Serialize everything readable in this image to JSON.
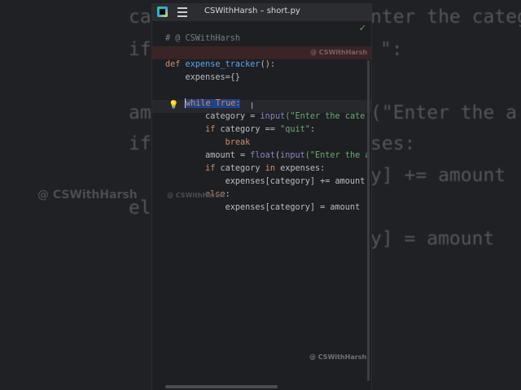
{
  "background": {
    "lines": [
      "cat",
      "if",
      "",
      "am",
      "if",
      "",
      "el"
    ],
    "right_lines": [
      "nter the categ",
      "\":",
      "(\"Enter the a",
      "ses:",
      "y] += amount",
      "y] = amount"
    ],
    "watermark": "@ CSWithHarsh"
  },
  "window": {
    "title": "CSWithHarsh – short.py",
    "app_icon": "pycharm-icon",
    "menu_icon": "hamburger-icon",
    "status_icon": "checkmark-icon",
    "status_color": "#5ea65e"
  },
  "code": {
    "comment": "# @ CSWithHarsh",
    "def_kw": "def",
    "func_name": "expense_tracker",
    "func_tail": "():",
    "expenses_init": "    expenses={}",
    "while_selected": "while True:",
    "cat_lhs": "        category = ",
    "cat_input": "input",
    "cat_str": "(\"Enter the cate",
    "if1_kw": "        if",
    "if1_mid": " category == ",
    "if1_str": "\"quit\"",
    "if1_tail": ":",
    "break_kw": "            break",
    "amt_lhs": "        amount = ",
    "amt_float": "float",
    "amt_paren": "(",
    "amt_input": "input",
    "amt_str": "(\"Enter the a",
    "if2_kw": "        if",
    "if2_mid": " category ",
    "if2_in": "in",
    "if2_tail": " expenses:",
    "add_line": "            expenses[category] += amount",
    "else_kw": "        else",
    "else_tail": ":",
    "set_line": "            expenses[category] = amount"
  },
  "watermarks": {
    "top": "@ CSWithHarsh",
    "left": "@ CSWithHarsh",
    "bottom": "@ CSWithHarsh"
  },
  "icons": {
    "bulb": "lightbulb-icon",
    "cursor": "text-cursor-icon"
  }
}
